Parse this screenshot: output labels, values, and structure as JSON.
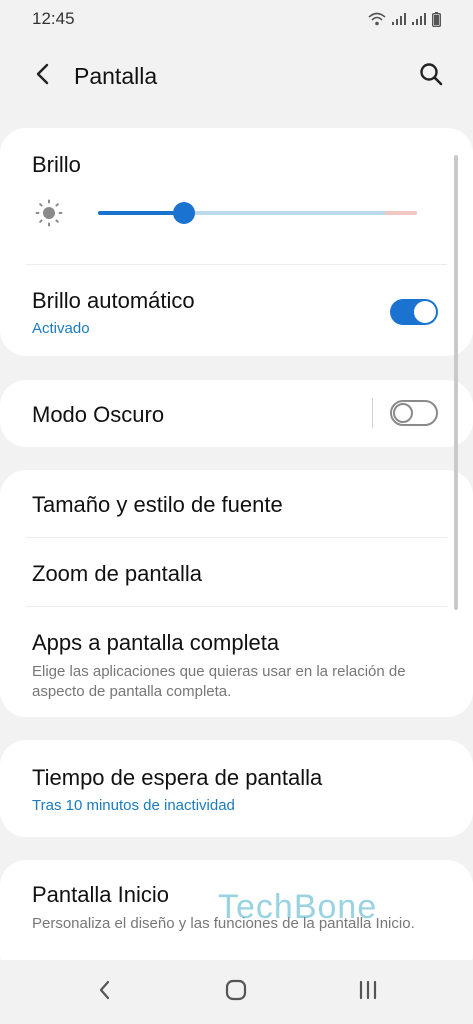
{
  "status_bar": {
    "time": "12:45",
    "icons": [
      "wifi-icon",
      "signal-icon",
      "signal-icon",
      "battery-icon"
    ]
  },
  "header": {
    "title": "Pantalla",
    "back_icon": "chevron-left-icon",
    "search_icon": "search-icon"
  },
  "brightness_card": {
    "title": "Brillo",
    "slider_icon": "sun-icon",
    "slider_value_percent": 27,
    "auto": {
      "title": "Brillo automático",
      "subtitle": "Activado",
      "toggle_on": true
    }
  },
  "dark_mode_card": {
    "title": "Modo Oscuro",
    "toggle_on": false
  },
  "font_card": {
    "items": [
      {
        "title": "Tamaño y estilo de fuente"
      },
      {
        "title": "Zoom de pantalla"
      },
      {
        "title": "Apps a pantalla completa",
        "description": "Elige las aplicaciones que quieras usar en la relación de aspecto de pantalla completa."
      }
    ]
  },
  "timeout_card": {
    "title": "Tiempo de espera de pantalla",
    "subtitle": "Tras 10 minutos de inactividad"
  },
  "home_card": {
    "title": "Pantalla Inicio",
    "description": "Personaliza el diseño y las funciones de la pantalla Inicio."
  },
  "watermark": "TechBone",
  "nav_bar": {
    "icons": [
      "back-icon",
      "home-icon",
      "recents-icon"
    ]
  },
  "colors": {
    "accent": "#1a73d0",
    "subtitle": "#1a7bbf",
    "background": "#f2f2f2",
    "card": "#ffffff"
  }
}
